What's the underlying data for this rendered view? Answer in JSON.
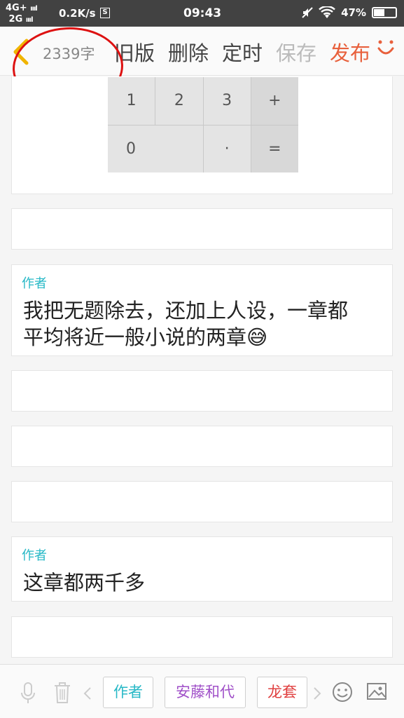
{
  "status": {
    "network_top": "4G+",
    "network_bottom": "2G",
    "speed": "0.2K/s",
    "s_badge": "S",
    "time": "09:43",
    "battery": "47%",
    "battery_level": 0.47
  },
  "toolbar": {
    "word_count": "2339字",
    "old_version": "旧版",
    "delete": "删除",
    "schedule": "定时",
    "save": "保存",
    "publish": "发布"
  },
  "calculator": {
    "keys": [
      "1",
      "2",
      "3",
      "+",
      "0",
      "·",
      "="
    ]
  },
  "comments": [
    {
      "author": "作者",
      "text_line1": "我把无题除去，还加上人设，一章都",
      "text_line2": "平均将近一般小说的两章😅"
    },
    {
      "author": "作者",
      "text_line1": "这章都两千多"
    }
  ],
  "bottombar": {
    "tags": [
      "作者",
      "安藤和代",
      "龙套"
    ],
    "tag_colors": [
      "#26b8c6",
      "#a050c8",
      "#e04040"
    ]
  },
  "colors": {
    "accent": "#e8603c",
    "author": "#26b8c6",
    "annotation": "#dd1111"
  }
}
